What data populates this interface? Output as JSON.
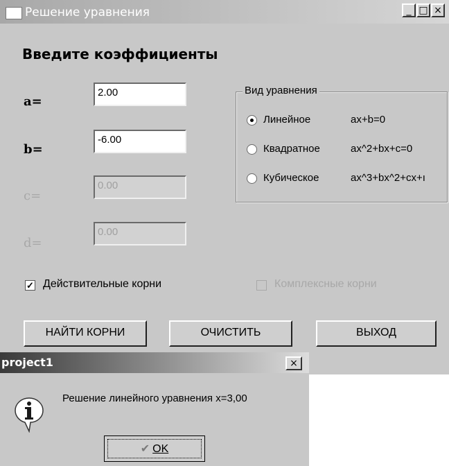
{
  "window": {
    "title": "Решение уравнения",
    "minimize_glyph": "_",
    "maximize_glyph": "□",
    "close_glyph": "×"
  },
  "form": {
    "heading": "Введите коэффициенты",
    "coefficients": [
      {
        "label": "a=",
        "value": "2.00",
        "enabled": true
      },
      {
        "label": "b=",
        "value": "-6.00",
        "enabled": true
      },
      {
        "label": "c=",
        "value": "0.00",
        "enabled": false
      },
      {
        "label": "d=",
        "value": "0.00",
        "enabled": false
      }
    ]
  },
  "equation_type": {
    "caption": "Вид уравнения",
    "options": [
      {
        "label": "Линейное",
        "formula": "ax+b=0",
        "selected": true
      },
      {
        "label": "Квадратное",
        "formula": "ax^2+bx+c=0",
        "selected": false
      },
      {
        "label": "Кубическое",
        "formula": "ax^3+bx^2+cx+ı",
        "selected": false
      }
    ]
  },
  "checkboxes": {
    "real_roots": {
      "label": "Действительные корни",
      "checked": true,
      "enabled": true,
      "mark": "✓"
    },
    "complex_roots": {
      "label": "Комплексные корни",
      "checked": false,
      "enabled": false
    }
  },
  "buttons": {
    "find_roots": "НАЙТИ КОРНИ",
    "clear": "ОЧИСТИТЬ",
    "exit": "ВЫХОД"
  },
  "dialog": {
    "title": "project1",
    "close_glyph": "×",
    "icon": "info-icon",
    "message": "Решение линейного уравнения x=3,00",
    "ok_check": "✔",
    "ok_label": "OK"
  }
}
